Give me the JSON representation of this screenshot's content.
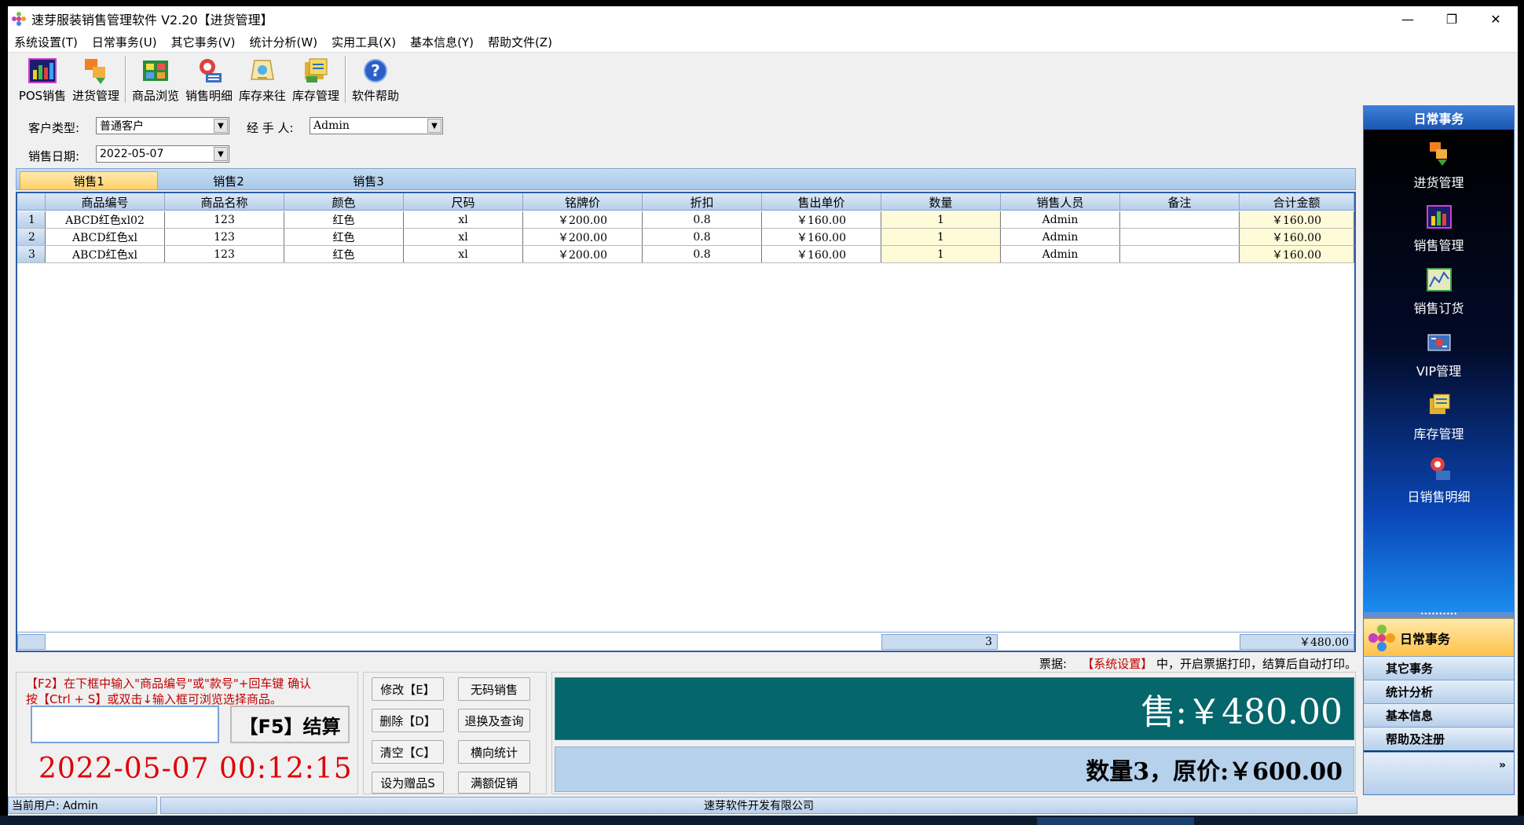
{
  "window": {
    "title": "速芽服装销售管理软件 V2.20【进货管理】",
    "controls": {
      "minimize": "—",
      "maximize": "❐",
      "close": "✕"
    }
  },
  "menu": [
    "系统设置(T)",
    "日常事务(U)",
    "其它事务(V)",
    "统计分析(W)",
    "实用工具(X)",
    "基本信息(Y)",
    "帮助文件(Z)"
  ],
  "toolbar": {
    "pos": "POS销售",
    "purchase": "进货管理",
    "browse": "商品浏览",
    "sales_detail": "销售明细",
    "stock_flow": "库存来往",
    "stock_manage": "库存管理",
    "help": "软件帮助"
  },
  "form": {
    "customer_type_label": "客户类型:",
    "customer_type_value": "普通客户",
    "handler_label": "经 手 人:",
    "handler_value": "Admin",
    "sale_date_label": "销售日期:",
    "sale_date_value": "2022-05-07"
  },
  "tabs": [
    "销售1",
    "销售2",
    "销售3"
  ],
  "table": {
    "headers": [
      "商品编号",
      "商品名称",
      "颜色",
      "尺码",
      "铭牌价",
      "折扣",
      "售出单价",
      "数量",
      "销售人员",
      "备注",
      "合计金额"
    ],
    "rows": [
      {
        "num": "1",
        "cells": [
          "ABCD红色xl02",
          "123",
          "红色",
          "xl",
          "￥200.00",
          "0.8",
          "￥160.00",
          "1",
          "Admin",
          "",
          "￥160.00"
        ]
      },
      {
        "num": "2",
        "cells": [
          "ABCD红色xl",
          "123",
          "红色",
          "xl",
          "￥200.00",
          "0.8",
          "￥160.00",
          "1",
          "Admin",
          "",
          "￥160.00"
        ]
      },
      {
        "num": "3",
        "cells": [
          "ABCD红色xl",
          "123",
          "红色",
          "xl",
          "￥200.00",
          "0.8",
          "￥160.00",
          "1",
          "Admin",
          "",
          "￥160.00"
        ]
      }
    ],
    "footer_qty": "3",
    "footer_total": "￥480.00"
  },
  "receipt_hint": {
    "prefix": "票据:",
    "link": "【系统设置】",
    "suffix": "中，开启票据打印，结算后自动打印。"
  },
  "entry": {
    "hint_line1": "【F2】在下框中输入\"商品编号\"或\"款号\"+回车键 确认",
    "hint_line2": "按【Ctrl + S】或双击↓输入框可浏览选择商品。",
    "input_value": "",
    "checkout": "【F5】结算",
    "clock": "2022-05-07  00:12:15"
  },
  "actions": {
    "modify": "修改【E】",
    "no_code_sale": "无码销售",
    "delete": "删除【D】",
    "return_query": "退换及查询",
    "clear": "清空【C】",
    "horizontal_stats": "横向统计",
    "set_gift": "设为赠品S",
    "promo": "满额促销"
  },
  "summary": {
    "sale_total": "售:￥480.00",
    "qty_price": "数量3，原价:￥600.00"
  },
  "sidebar": {
    "header": "日常事务",
    "items": [
      "进货管理",
      "销售管理",
      "销售订货",
      "VIP管理",
      "库存管理",
      "日销售明细"
    ],
    "active": "日常事务",
    "buttons": [
      "其它事务",
      "统计分析",
      "基本信息",
      "帮助及注册"
    ],
    "expand": "»"
  },
  "status": {
    "user": "当前用户: Admin",
    "company": "速芽软件开发有限公司"
  },
  "colors": {
    "accent_blue": "#2a5ea8",
    "total_bg": "#05666b",
    "hint_red": "#c00000",
    "clock_red": "#e00000"
  }
}
